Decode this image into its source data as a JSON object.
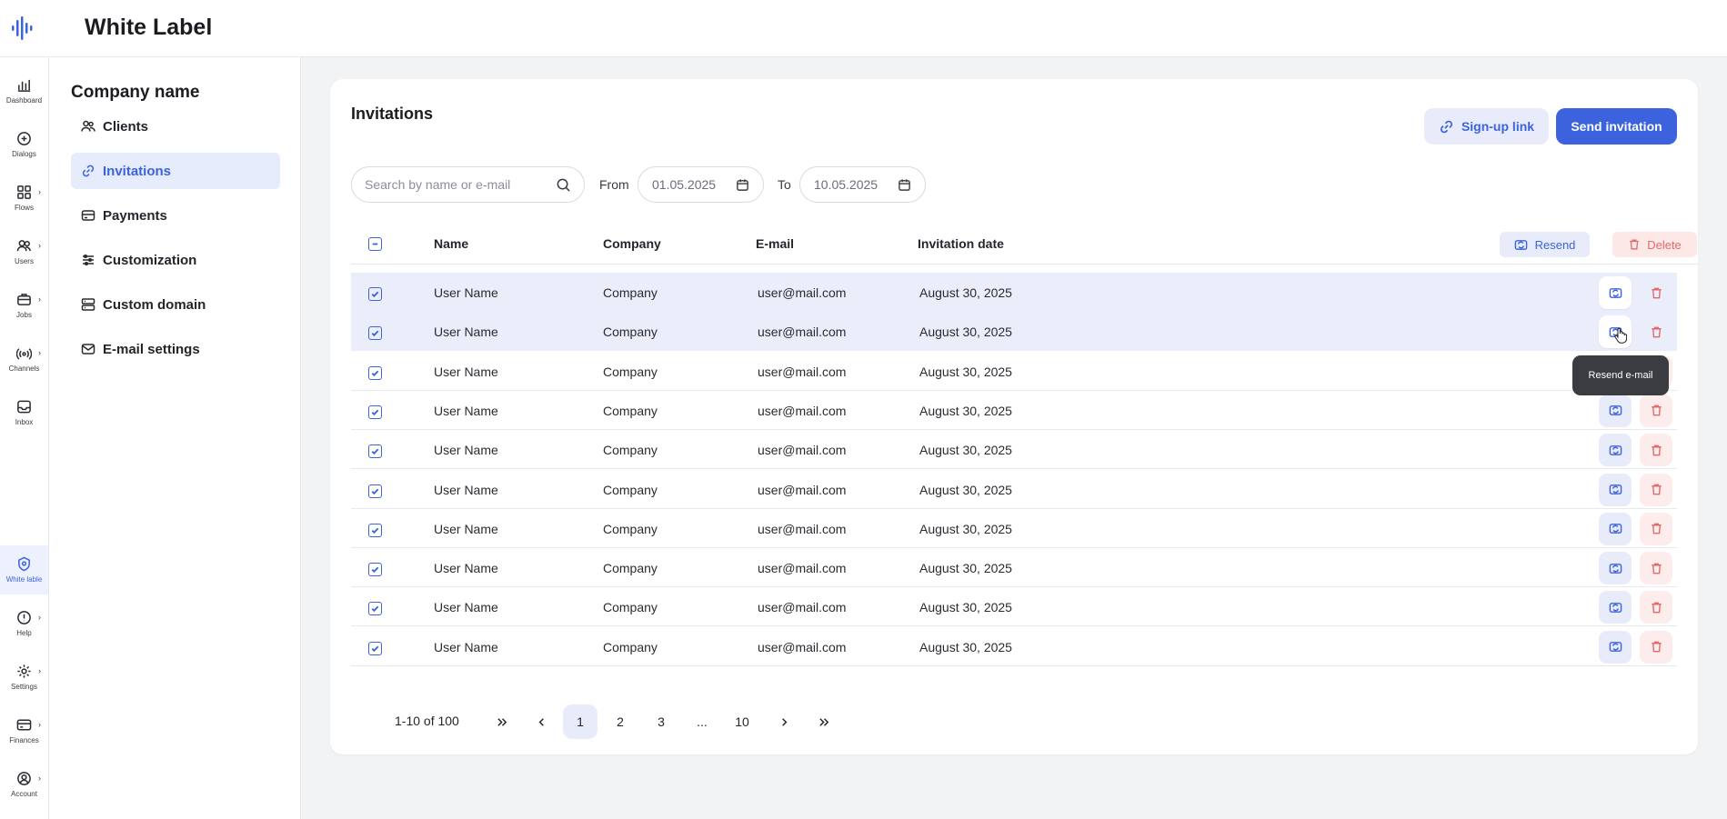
{
  "header": {
    "title": "White Label"
  },
  "rail": {
    "items": [
      {
        "label": "Dashboard",
        "icon": "bar-chart-icon",
        "chevron": false,
        "active": false
      },
      {
        "label": "Dialogs",
        "icon": "dialogs-icon",
        "chevron": false,
        "active": false
      },
      {
        "label": "Flows",
        "icon": "grid-icon",
        "chevron": true,
        "active": false
      },
      {
        "label": "Users",
        "icon": "users-icon",
        "chevron": true,
        "active": false
      },
      {
        "label": "Jobs",
        "icon": "briefcase-icon",
        "chevron": true,
        "active": false
      },
      {
        "label": "Channels",
        "icon": "broadcast-icon",
        "chevron": true,
        "active": false
      },
      {
        "label": "Inbox",
        "icon": "inbox-icon",
        "chevron": false,
        "active": false
      },
      {
        "label": "White lable",
        "icon": "white-label-icon",
        "chevron": false,
        "active": true
      },
      {
        "label": "Help",
        "icon": "help-icon",
        "chevron": true,
        "active": false
      },
      {
        "label": "Settings",
        "icon": "gear-icon",
        "chevron": true,
        "active": false
      },
      {
        "label": "Finances",
        "icon": "card-icon",
        "chevron": true,
        "active": false
      },
      {
        "label": "Account",
        "icon": "account-icon",
        "chevron": true,
        "active": false
      }
    ]
  },
  "subnav": {
    "company": "Company name",
    "items": [
      {
        "label": "Clients",
        "icon": "clients-icon",
        "active": false
      },
      {
        "label": "Invitations",
        "icon": "link-icon",
        "active": true
      },
      {
        "label": "Payments",
        "icon": "payments-icon",
        "active": false
      },
      {
        "label": "Customization",
        "icon": "sliders-icon",
        "active": false
      },
      {
        "label": "Custom domain",
        "icon": "server-icon",
        "active": false
      },
      {
        "label": "E-mail settings",
        "icon": "mail-icon",
        "active": false
      }
    ]
  },
  "main": {
    "title": "Invitations",
    "signup_label": "Sign-up link",
    "send_label": "Send invitation",
    "search_placeholder": "Search by name or e-mail",
    "from_label": "From",
    "from_value": "01.05.2025",
    "to_label": "To",
    "to_value": "10.05.2025"
  },
  "table": {
    "columns": [
      "Name",
      "Company",
      "E-mail",
      "Invitation date"
    ],
    "bulk_resend": "Resend",
    "bulk_delete": "Delete",
    "rows": [
      {
        "name": "User Name",
        "company": "Company",
        "email": "user@mail.com",
        "date": "August 30, 2025",
        "selected": true
      },
      {
        "name": "User Name",
        "company": "Company",
        "email": "user@mail.com",
        "date": "August 30, 2025",
        "selected": true
      },
      {
        "name": "User Name",
        "company": "Company",
        "email": "user@mail.com",
        "date": "August 30, 2025",
        "selected": false
      },
      {
        "name": "User Name",
        "company": "Company",
        "email": "user@mail.com",
        "date": "August 30, 2025",
        "selected": false
      },
      {
        "name": "User Name",
        "company": "Company",
        "email": "user@mail.com",
        "date": "August 30, 2025",
        "selected": false
      },
      {
        "name": "User Name",
        "company": "Company",
        "email": "user@mail.com",
        "date": "August 30, 2025",
        "selected": false
      },
      {
        "name": "User Name",
        "company": "Company",
        "email": "user@mail.com",
        "date": "August 30, 2025",
        "selected": false
      },
      {
        "name": "User Name",
        "company": "Company",
        "email": "user@mail.com",
        "date": "August 30, 2025",
        "selected": false
      },
      {
        "name": "User Name",
        "company": "Company",
        "email": "user@mail.com",
        "date": "August 30, 2025",
        "selected": false
      },
      {
        "name": "User Name",
        "company": "Company",
        "email": "user@mail.com",
        "date": "August 30, 2025",
        "selected": false
      }
    ],
    "tooltip": "Resend e-mail"
  },
  "pagination": {
    "summary": "1-10 of 100",
    "pages": [
      "1",
      "2",
      "3",
      "...",
      "10"
    ],
    "current": "1"
  },
  "colors": {
    "accent": "#3c63dd",
    "danger": "#e36a6a",
    "selected_row": "#eaeefb"
  }
}
